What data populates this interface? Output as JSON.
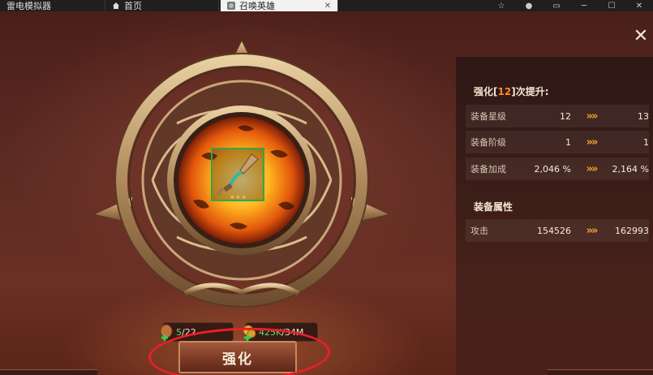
{
  "window": {
    "tabs": [
      {
        "label": "雷电模拟器",
        "active": false
      },
      {
        "label": "首页",
        "active": false
      },
      {
        "label": "召唤英雄",
        "active": true
      }
    ],
    "tab_close": "✕",
    "controls": [
      "☆",
      "●",
      "▭",
      "─",
      "☐",
      "✕"
    ]
  },
  "game": {
    "close_symbol": "✕",
    "item": {
      "stars": "★★★"
    },
    "upgrade_panel": {
      "title_prefix": "强化[",
      "title_level": "12",
      "title_suffix": "]次提升:",
      "rows": [
        {
          "label": "装备星级",
          "from": "12",
          "to": "13"
        },
        {
          "label": "装备阶级",
          "from": "1",
          "to": "1"
        },
        {
          "label": "装备加成",
          "from": "2,046 %",
          "to": "2,164 %"
        }
      ],
      "attr_title": "装备属性",
      "attr_rows": [
        {
          "label": "攻击",
          "from": "154526",
          "to": "162993"
        }
      ],
      "arrow_symbol": "»»"
    },
    "resources": [
      {
        "icon": "enhance-stone-icon",
        "current": "5",
        "required": "/22"
      },
      {
        "icon": "gold-coin-icon",
        "current": "425K",
        "required": "/34M"
      }
    ],
    "enhance_button": "强化"
  },
  "colors": {
    "accent_orange": "#ff8a2a",
    "arrow_gold": "#f0a030",
    "resource_green": "#5ee06a",
    "item_border_green": "#2ea84a",
    "annotation_red": "#e8202a"
  }
}
